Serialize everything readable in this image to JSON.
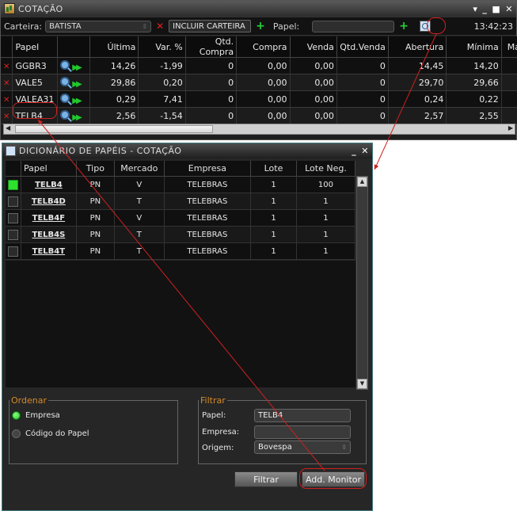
{
  "quote_window": {
    "title": "COTAÇÃO",
    "toolbar": {
      "carteira_label": "Carteira:",
      "carteira_value": "BATISTA",
      "incluir_label": "INCLUIR CARTEIRA",
      "papel_label": "Papel:",
      "papel_value": "",
      "time": "13:42:23"
    },
    "columns": [
      "Papel",
      "",
      "Última",
      "Var. %",
      "Qtd. Compra",
      "Compra",
      "Venda",
      "Qtd.Venda",
      "Abertura",
      "Mínima",
      "Má"
    ],
    "rows": [
      {
        "papel": "GGBR3",
        "ultima": "14,26",
        "var": "-1,99",
        "var_sign": "neg",
        "qtd_compra": "0",
        "compra": "0,00",
        "venda": "0,00",
        "qtd_venda": "0",
        "abertura": "14,45",
        "minima": "14,20"
      },
      {
        "papel": "VALE5",
        "ultima": "29,86",
        "var": "0,20",
        "var_sign": "pos",
        "qtd_compra": "0",
        "compra": "0,00",
        "venda": "0,00",
        "qtd_venda": "0",
        "abertura": "29,70",
        "minima": "29,66"
      },
      {
        "papel": "VALEA31",
        "ultima": "0,29",
        "var": "7,41",
        "var_sign": "pos",
        "qtd_compra": "0",
        "compra": "0,00",
        "venda": "0,00",
        "qtd_venda": "0",
        "abertura": "0,24",
        "minima": "0,22"
      },
      {
        "papel": "TELB4",
        "ultima": "2,56",
        "var": "-1,54",
        "var_sign": "neg",
        "qtd_compra": "0",
        "compra": "0,00",
        "venda": "0,00",
        "qtd_venda": "0",
        "abertura": "2,57",
        "minima": "2,55"
      }
    ]
  },
  "dict_window": {
    "title": "DICIONÁRIO DE PAPÉIS - COTAÇÃO",
    "columns": [
      "Papel",
      "Tipo",
      "Mercado",
      "Empresa",
      "Lote",
      "Lote Neg."
    ],
    "rows": [
      {
        "checked": true,
        "papel": "TELB4",
        "tipo": "PN",
        "mercado": "V",
        "empresa": "TELEBRAS",
        "lote": "1",
        "lote_neg": "100"
      },
      {
        "checked": false,
        "papel": "TELB4D",
        "tipo": "PN",
        "mercado": "T",
        "empresa": "TELEBRAS",
        "lote": "1",
        "lote_neg": "1"
      },
      {
        "checked": false,
        "papel": "TELB4F",
        "tipo": "PN",
        "mercado": "V",
        "empresa": "TELEBRAS",
        "lote": "1",
        "lote_neg": "1"
      },
      {
        "checked": false,
        "papel": "TELB4S",
        "tipo": "PN",
        "mercado": "T",
        "empresa": "TELEBRAS",
        "lote": "1",
        "lote_neg": "1"
      },
      {
        "checked": false,
        "papel": "TELB4T",
        "tipo": "PN",
        "mercado": "T",
        "empresa": "TELEBRAS",
        "lote": "1",
        "lote_neg": "1"
      }
    ],
    "ordenar": {
      "legend": "Ordenar",
      "options": [
        "Empresa",
        "Código do Papel"
      ],
      "selected": "Empresa"
    },
    "filtrar": {
      "legend": "Filtrar",
      "papel_label": "Papel:",
      "papel_value": "TELB4",
      "empresa_label": "Empresa:",
      "empresa_value": "",
      "origem_label": "Origem:",
      "origem_value": "Bovespa"
    },
    "buttons": {
      "filtrar": "Filtrar",
      "add_monitor": "Add. Monitor"
    }
  },
  "colors": {
    "annotation": "#d02020",
    "positive": "#21d42e",
    "negative": "#e02222",
    "legend": "#d48a2a"
  }
}
